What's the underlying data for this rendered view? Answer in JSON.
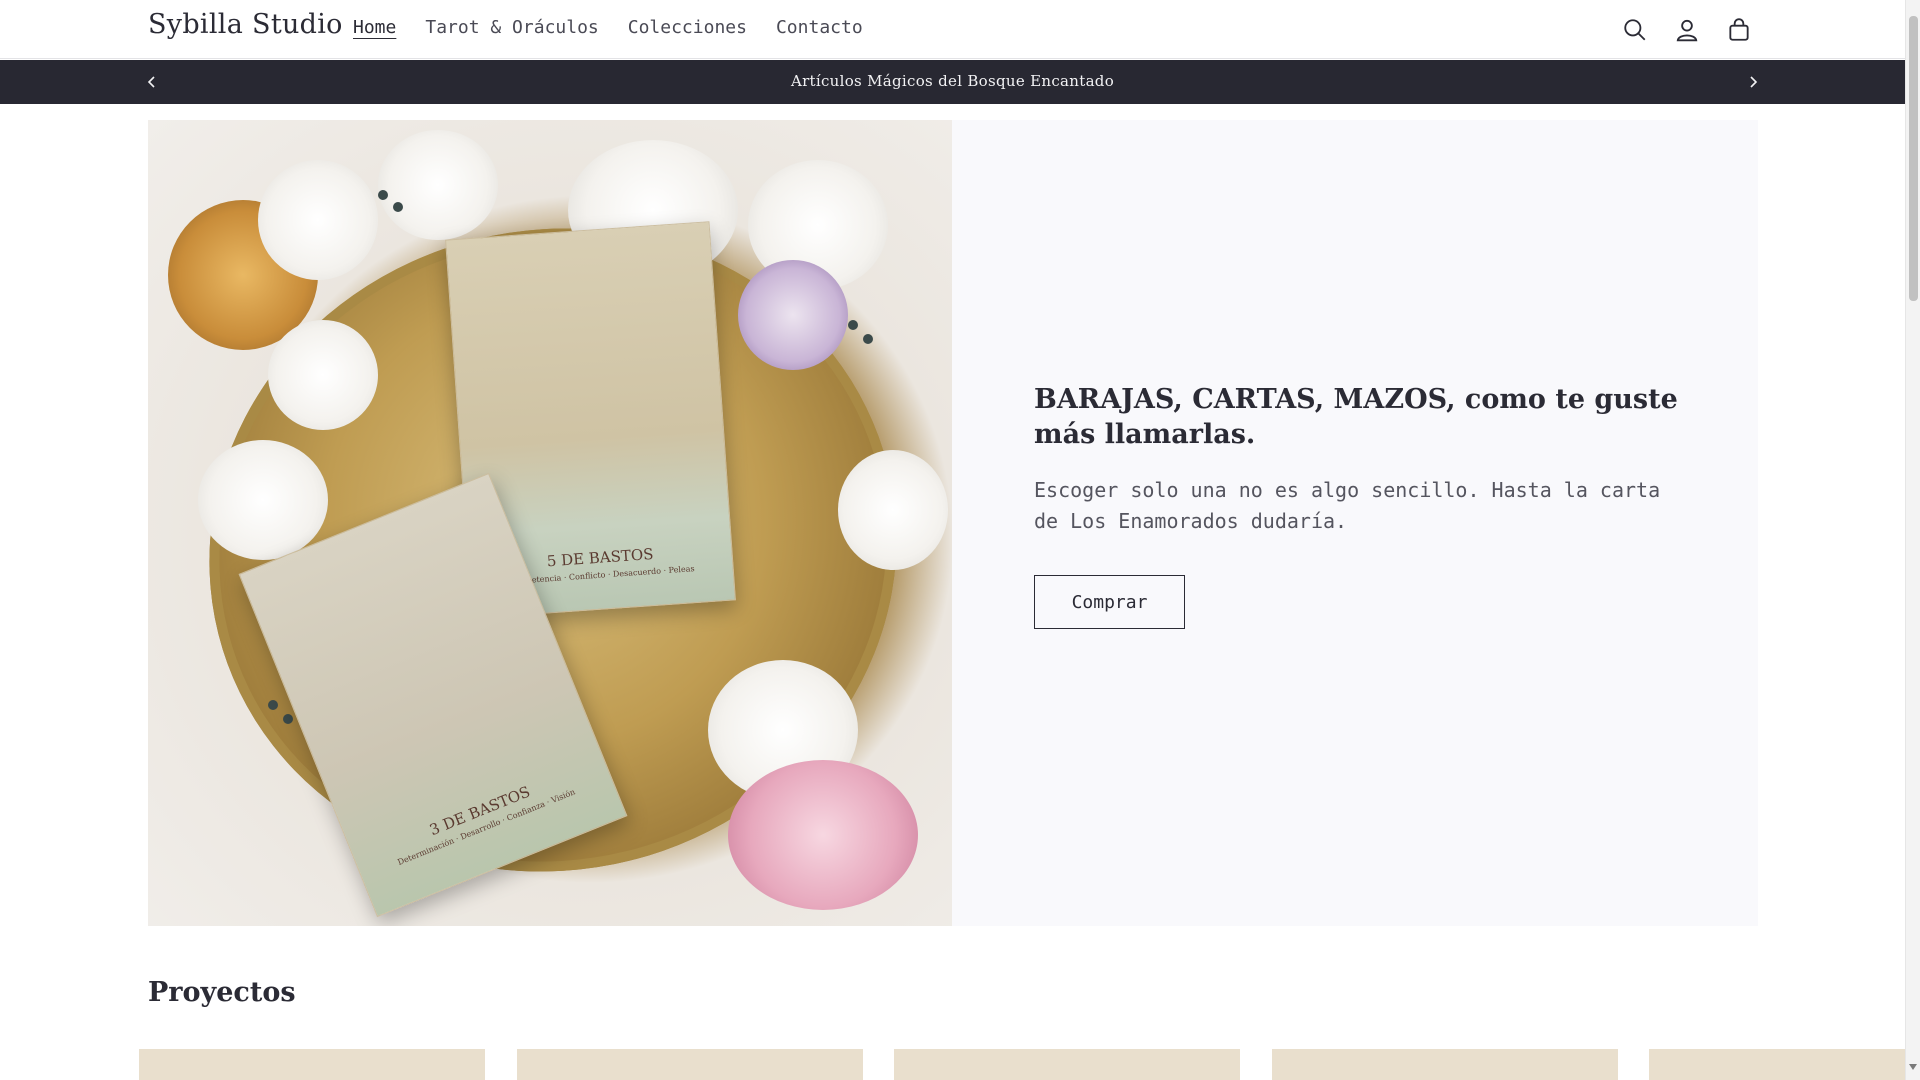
{
  "header": {
    "logo": "Sybilla Studio",
    "nav": [
      {
        "label": "Home",
        "active": true
      },
      {
        "label": "Tarot & Oráculos",
        "active": false
      },
      {
        "label": "Colecciones",
        "active": false
      },
      {
        "label": "Contacto",
        "active": false
      }
    ],
    "icons": [
      "search-icon",
      "account-icon",
      "cart-icon"
    ]
  },
  "announcement": {
    "text": "Artículos Mágicos del Bosque Encantado"
  },
  "hero": {
    "image_cards": {
      "card_a_title": "5 DE BASTOS",
      "card_a_sub": "Competencia · Conflicto · Desacuerdo · Peleas",
      "card_b_title": "3 DE BASTOS",
      "card_b_sub": "Determinación · Desarrollo · Confianza · Visión"
    },
    "heading": "BARAJAS, CARTAS, MAZOS, como te guste más llamarlas.",
    "text": "Escoger solo una no es algo sencillo. Hasta la carta de Los Enamorados dudaría.",
    "button_label": "Comprar"
  },
  "projects": {
    "title": "Proyectos",
    "card_color": "#e9dfcd"
  },
  "colors": {
    "announcement_bg": "#282832",
    "hero_panel_bg": "#f9f9fc",
    "text": "#2b2b35"
  }
}
